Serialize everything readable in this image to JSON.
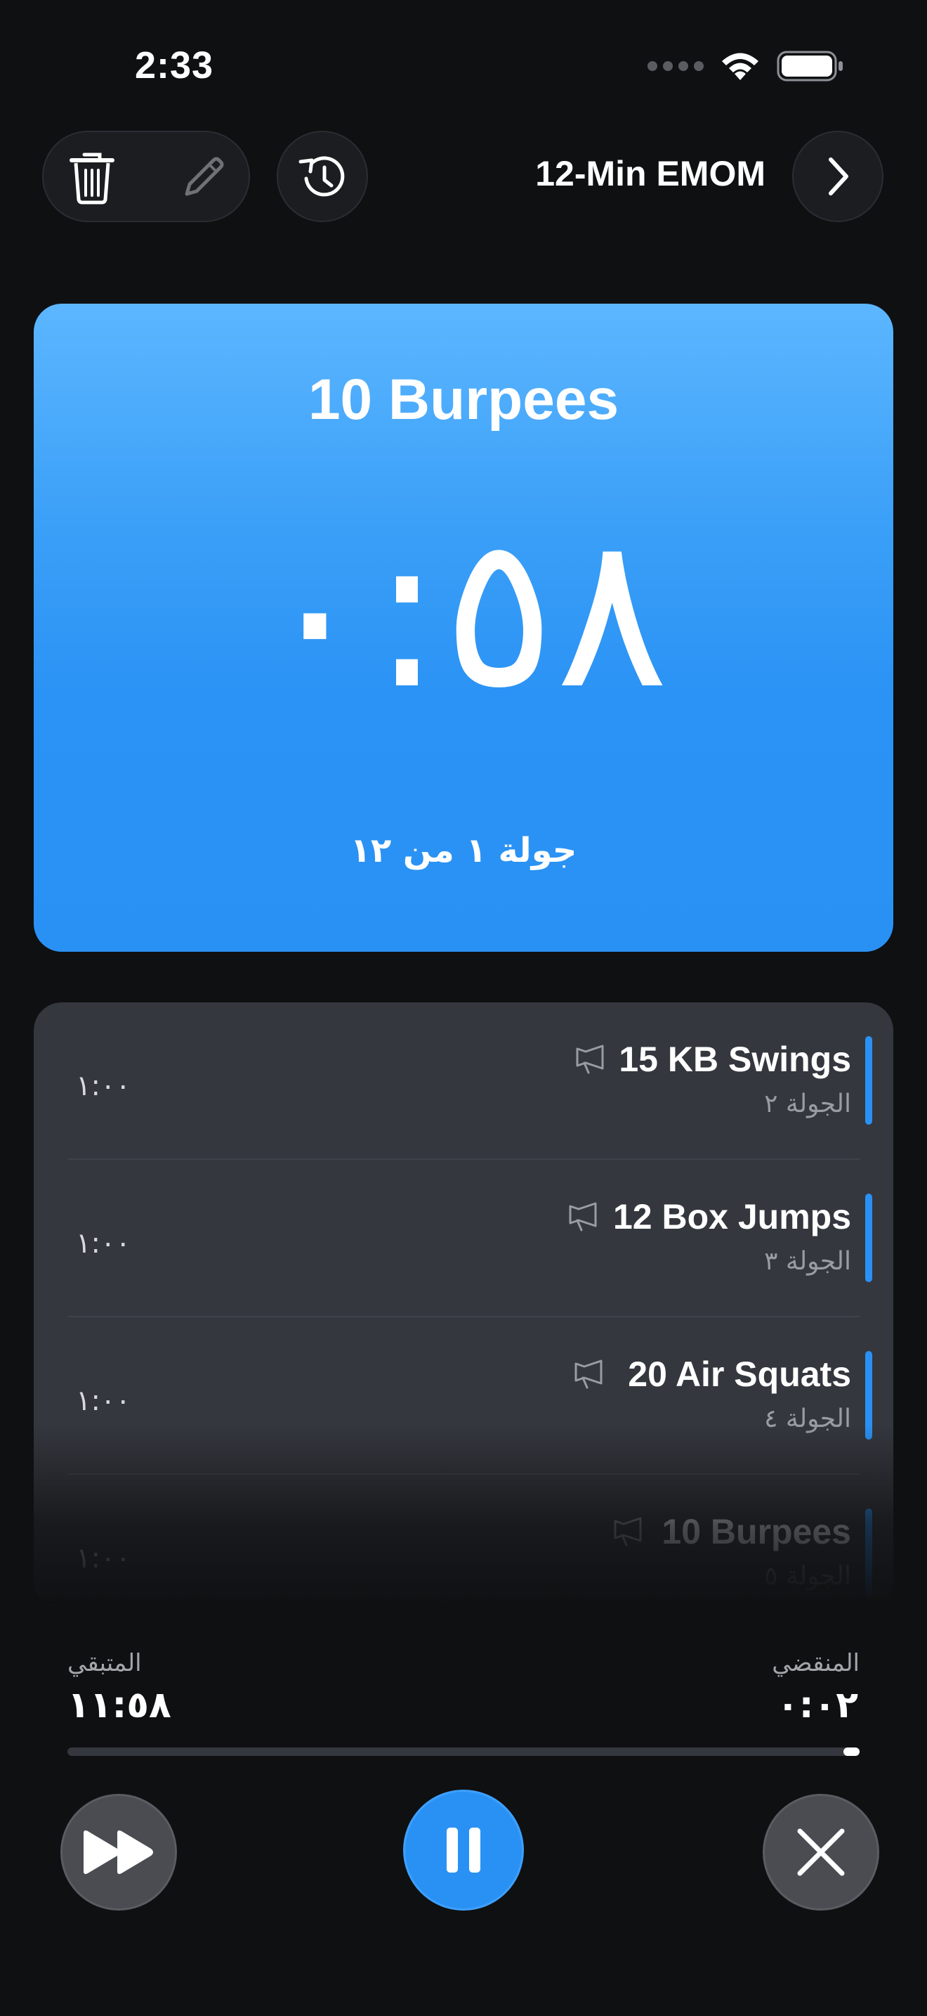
{
  "status_bar": {
    "time": "2:33"
  },
  "header": {
    "workout_title": "12-Min EMOM"
  },
  "current": {
    "exercise": "10 Burpees",
    "timer": "٠:٥٨",
    "round_text": "جولة ١ من ١٢"
  },
  "upcoming": [
    {
      "name": "15 KB Swings",
      "round": "الجولة ٢",
      "duration": "١:٠٠"
    },
    {
      "name": "12 Box Jumps",
      "round": "الجولة ٣",
      "duration": "١:٠٠"
    },
    {
      "name": "20 Air Squats",
      "round": "الجولة ٤",
      "duration": "١:٠٠"
    },
    {
      "name": "10 Burpees",
      "round": "الجولة ٥",
      "duration": "١:٠٠"
    }
  ],
  "progress": {
    "elapsed_label": "المنقضي",
    "elapsed_value": "٠:٠٢",
    "remaining_label": "المتبقي",
    "remaining_value": "١١:٥٨",
    "fraction_complete": 0.0028
  },
  "colors": {
    "accent": "#2a91f4",
    "background": "#0f1012",
    "card": "#34373e"
  },
  "icons": {
    "delete": "trash-icon",
    "edit": "pencil-icon",
    "history": "history-icon",
    "next": "chevron-right-icon",
    "cue": "megaphone-icon",
    "skip": "fast-forward-icon",
    "pause": "pause-icon",
    "close": "close-icon"
  }
}
